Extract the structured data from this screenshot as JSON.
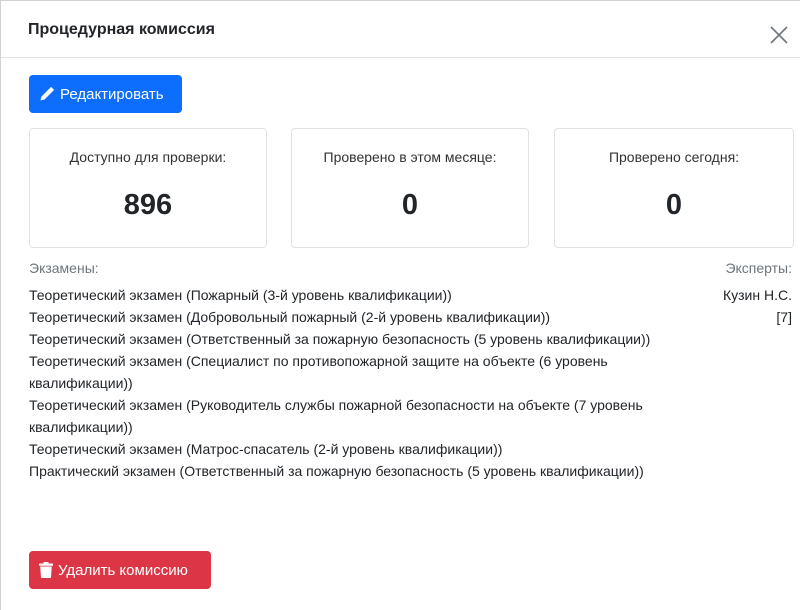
{
  "modal": {
    "title": "Процедурная комиссия",
    "close_icon": "close-icon"
  },
  "actions": {
    "edit_label": "Редактировать",
    "edit_icon": "pencil-icon",
    "delete_label": "Удалить комиссию",
    "delete_icon": "trash-icon"
  },
  "stats": [
    {
      "label": "Доступно для проверки:",
      "value": "896"
    },
    {
      "label": "Проверено в этом месяце:",
      "value": "0"
    },
    {
      "label": "Проверено сегодня:",
      "value": "0"
    }
  ],
  "exams": {
    "header": "Экзамены:",
    "items": [
      "Теоретический экзамен (Пожарный (3-й уровень квалификации))",
      "Теоретический экзамен (Добровольный пожарный (2-й уровень квалификации))",
      "Теоретический экзамен (Ответственный за пожарную безопасность (5 уровень квалификации))",
      "Теоретический экзамен (Специалист по противопожарной защите на объекте (6 уровень квалификации))",
      "Теоретический экзамен (Руководитель службы пожарной безопасности на объекте (7 уровень квалификации))",
      "Теоретический экзамен (Матрос-спасатель (2-й уровень квалификации))",
      "Практический экзамен (Ответственный за пожарную безопасность (5 уровень квалификации))"
    ]
  },
  "experts": {
    "header": "Эксперты:",
    "items": [
      "Кузин Н.С.",
      "[7]"
    ]
  },
  "colors": {
    "primary": "#0d6efd",
    "danger": "#dc3545",
    "muted": "#6c757d"
  }
}
